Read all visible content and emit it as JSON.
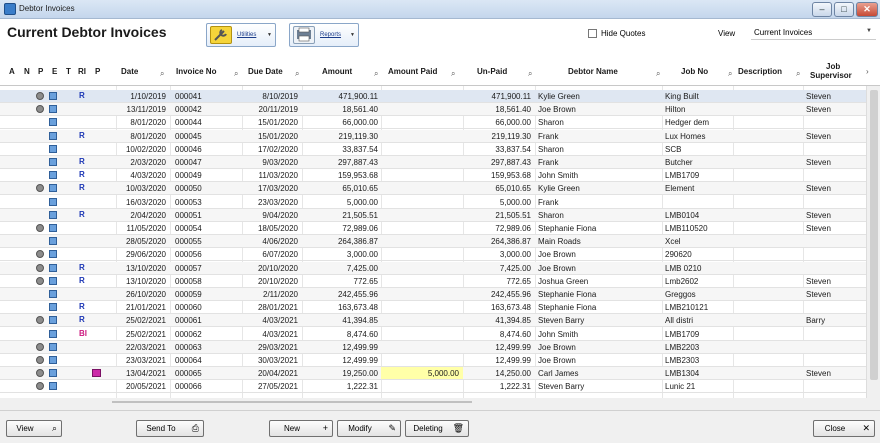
{
  "window": {
    "title": "Debtor Invoices",
    "controls": {
      "minimize": "–",
      "maximize": "□",
      "close": "✕"
    }
  },
  "header": {
    "page_title": "Current Debtor Invoices",
    "utilities_label": "Utilities",
    "reports_label": "Reports",
    "hide_quotes_label": "Hide Quotes",
    "hide_quotes_checked": false,
    "view_label": "View",
    "view_value": "Current Invoices"
  },
  "columns": {
    "a": "A",
    "n": "N",
    "p": "P",
    "e": "E",
    "t": "T",
    "ri": "RI",
    "p2": "P",
    "date": "Date",
    "invoice_no": "Invoice No",
    "due_date": "Due Date",
    "amount": "Amount",
    "amount_paid": "Amount Paid",
    "unpaid": "Un-Paid",
    "debtor_name": "Debtor Name",
    "job_no": "Job No",
    "description": "Description",
    "job_supervisor_1": "Job",
    "job_supervisor_2": "Supervisor"
  },
  "rows": [
    {
      "a": true,
      "e": true,
      "ri": "R",
      "date": "1/10/2019",
      "invoice_no": "000041",
      "due_date": "8/10/2019",
      "amount": "471,900.11",
      "paid": "",
      "unpaid": "471,900.11",
      "debtor": "Kylie Green",
      "job": "King Built",
      "desc": "",
      "sup": "Steven"
    },
    {
      "a": true,
      "e": true,
      "ri": "",
      "date": "13/11/2019",
      "invoice_no": "000042",
      "due_date": "20/11/2019",
      "amount": "18,561.40",
      "paid": "",
      "unpaid": "18,561.40",
      "debtor": "Joe Brown",
      "job": "Hilton",
      "desc": "",
      "sup": "Steven"
    },
    {
      "a": false,
      "e": true,
      "ri": "",
      "date": "8/01/2020",
      "invoice_no": "000044",
      "due_date": "15/01/2020",
      "amount": "66,000.00",
      "paid": "",
      "unpaid": "66,000.00",
      "debtor": "Sharon",
      "job": "Hedger dem",
      "desc": "",
      "sup": ""
    },
    {
      "a": false,
      "e": true,
      "ri": "R",
      "date": "8/01/2020",
      "invoice_no": "000045",
      "due_date": "15/01/2020",
      "amount": "219,119.30",
      "paid": "",
      "unpaid": "219,119.30",
      "debtor": "Frank",
      "job": "Lux Homes",
      "desc": "",
      "sup": "Steven"
    },
    {
      "a": false,
      "e": true,
      "ri": "",
      "date": "10/02/2020",
      "invoice_no": "000046",
      "due_date": "17/02/2020",
      "amount": "33,837.54",
      "paid": "",
      "unpaid": "33,837.54",
      "debtor": "Sharon",
      "job": "SCB",
      "desc": "",
      "sup": ""
    },
    {
      "a": false,
      "e": true,
      "ri": "R",
      "date": "2/03/2020",
      "invoice_no": "000047",
      "due_date": "9/03/2020",
      "amount": "297,887.43",
      "paid": "",
      "unpaid": "297,887.43",
      "debtor": "Frank",
      "job": "Butcher",
      "desc": "",
      "sup": "Steven"
    },
    {
      "a": false,
      "e": true,
      "ri": "R",
      "date": "4/03/2020",
      "invoice_no": "000049",
      "due_date": "11/03/2020",
      "amount": "159,953.68",
      "paid": "",
      "unpaid": "159,953.68",
      "debtor": "John Smith",
      "job": "LMB1709",
      "desc": "",
      "sup": ""
    },
    {
      "a": true,
      "e": true,
      "ri": "R",
      "date": "10/03/2020",
      "invoice_no": "000050",
      "due_date": "17/03/2020",
      "amount": "65,010.65",
      "paid": "",
      "unpaid": "65,010.65",
      "debtor": "Kylie Green",
      "job": "Element",
      "desc": "",
      "sup": "Steven"
    },
    {
      "a": false,
      "e": true,
      "ri": "",
      "date": "16/03/2020",
      "invoice_no": "000053",
      "due_date": "23/03/2020",
      "amount": "5,000.00",
      "paid": "",
      "unpaid": "5,000.00",
      "debtor": "Frank",
      "job": "",
      "desc": "",
      "sup": ""
    },
    {
      "a": false,
      "e": true,
      "ri": "R",
      "date": "2/04/2020",
      "invoice_no": "000051",
      "due_date": "9/04/2020",
      "amount": "21,505.51",
      "paid": "",
      "unpaid": "21,505.51",
      "debtor": "Sharon",
      "job": "LMB0104",
      "desc": "",
      "sup": "Steven"
    },
    {
      "a": true,
      "e": true,
      "ri": "",
      "date": "11/05/2020",
      "invoice_no": "000054",
      "due_date": "18/05/2020",
      "amount": "72,989.06",
      "paid": "",
      "unpaid": "72,989.06",
      "debtor": "Stephanie Fiona",
      "job": "LMB110520",
      "desc": "",
      "sup": "Steven"
    },
    {
      "a": false,
      "e": true,
      "ri": "",
      "date": "28/05/2020",
      "invoice_no": "000055",
      "due_date": "4/06/2020",
      "amount": "264,386.87",
      "paid": "",
      "unpaid": "264,386.87",
      "debtor": "Main Roads",
      "job": "Xcel",
      "desc": "",
      "sup": ""
    },
    {
      "a": true,
      "e": true,
      "ri": "",
      "date": "29/06/2020",
      "invoice_no": "000056",
      "due_date": "6/07/2020",
      "amount": "3,000.00",
      "paid": "",
      "unpaid": "3,000.00",
      "debtor": "Joe Brown",
      "job": "290620",
      "desc": "",
      "sup": ""
    },
    {
      "a": true,
      "e": true,
      "ri": "R",
      "date": "13/10/2020",
      "invoice_no": "000057",
      "due_date": "20/10/2020",
      "amount": "7,425.00",
      "paid": "",
      "unpaid": "7,425.00",
      "debtor": "Joe Brown",
      "job": "LMB 0210",
      "desc": "",
      "sup": ""
    },
    {
      "a": true,
      "e": true,
      "ri": "R",
      "date": "13/10/2020",
      "invoice_no": "000058",
      "due_date": "20/10/2020",
      "amount": "772.65",
      "paid": "",
      "unpaid": "772.65",
      "debtor": "Joshua Green",
      "job": "Lmb2602",
      "desc": "",
      "sup": "Steven"
    },
    {
      "a": false,
      "e": true,
      "ri": "",
      "date": "26/10/2020",
      "invoice_no": "000059",
      "due_date": "2/11/2020",
      "amount": "242,455.96",
      "paid": "",
      "unpaid": "242,455.96",
      "debtor": "Stephanie Fiona",
      "job": "Greggos",
      "desc": "",
      "sup": "Steven"
    },
    {
      "a": false,
      "e": true,
      "ri": "R",
      "date": "21/01/2021",
      "invoice_no": "000060",
      "due_date": "28/01/2021",
      "amount": "163,673.48",
      "paid": "",
      "unpaid": "163,673.48",
      "debtor": "Stephanie Fiona",
      "job": "LMB210121",
      "desc": "",
      "sup": ""
    },
    {
      "a": true,
      "e": true,
      "ri": "R",
      "date": "25/02/2021",
      "invoice_no": "000061",
      "due_date": "4/03/2021",
      "amount": "41,394.85",
      "paid": "",
      "unpaid": "41,394.85",
      "debtor": "Steven Barry",
      "job": "All distri",
      "desc": "",
      "sup": "Barry"
    },
    {
      "a": false,
      "e": true,
      "ri": "BI",
      "date": "25/02/2021",
      "invoice_no": "000062",
      "due_date": "4/03/2021",
      "amount": "8,474.60",
      "paid": "",
      "unpaid": "8,474.60",
      "debtor": "John Smith",
      "job": "LMB1709",
      "desc": "",
      "sup": ""
    },
    {
      "a": true,
      "e": true,
      "ri": "",
      "date": "22/03/2021",
      "invoice_no": "000063",
      "due_date": "29/03/2021",
      "amount": "12,499.99",
      "paid": "",
      "unpaid": "12,499.99",
      "debtor": "Joe Brown",
      "job": "LMB2203",
      "desc": "",
      "sup": ""
    },
    {
      "a": true,
      "e": true,
      "ri": "",
      "date": "23/03/2021",
      "invoice_no": "000064",
      "due_date": "30/03/2021",
      "amount": "12,499.99",
      "paid": "",
      "unpaid": "12,499.99",
      "debtor": "Joe Brown",
      "job": "LMB2303",
      "desc": "",
      "sup": ""
    },
    {
      "a": true,
      "e": true,
      "ri": "",
      "note": true,
      "date": "13/04/2021",
      "invoice_no": "000065",
      "due_date": "20/04/2021",
      "amount": "19,250.00",
      "paid": "5,000.00",
      "unpaid": "14,250.00",
      "debtor": "Carl James",
      "job": "LMB1304",
      "desc": "",
      "sup": "Steven"
    },
    {
      "a": true,
      "e": true,
      "ri": "",
      "date": "20/05/2021",
      "invoice_no": "000066",
      "due_date": "27/05/2021",
      "amount": "1,222.31",
      "paid": "",
      "unpaid": "1,222.31",
      "debtor": "Steven Barry",
      "job": "Lunic 21",
      "desc": "",
      "sup": ""
    }
  ],
  "footer": {
    "view_label": "View",
    "send_to_label": "Send To",
    "new_label": "New",
    "modify_label": "Modify",
    "deleting_label": "Deleting",
    "close_label": "Close"
  }
}
